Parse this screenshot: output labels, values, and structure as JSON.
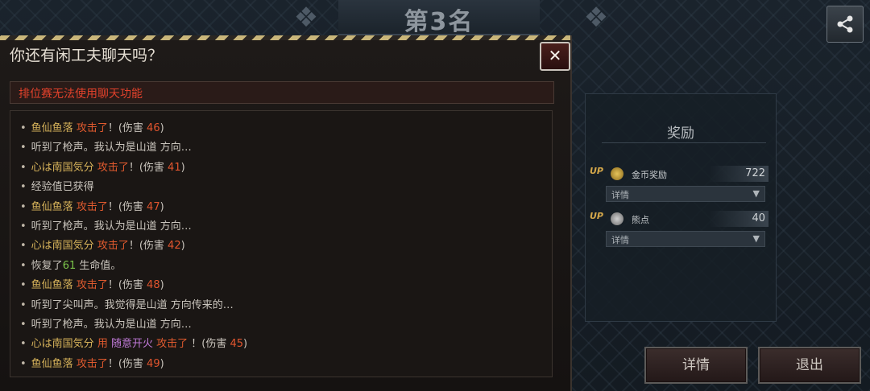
{
  "header": {
    "rank_title": "第3名"
  },
  "popup": {
    "title": "你还有闲工夫聊天吗？",
    "close_label": "✕",
    "notice": "排位赛无法使用聊天功能",
    "log": [
      {
        "parts": [
          {
            "t": "鱼仙鱼落",
            "c": "name"
          },
          {
            "t": "  攻击了",
            "c": "atk"
          },
          {
            "t": "！(伤害 ",
            "c": "plain"
          },
          {
            "t": "46",
            "c": "num"
          },
          {
            "t": ")",
            "c": "plain"
          }
        ]
      },
      {
        "parts": [
          {
            "t": "听到了枪声。我认为是山道 方向…",
            "c": "plain"
          }
        ]
      },
      {
        "parts": [
          {
            "t": "心は南国気分",
            "c": "name"
          },
          {
            "t": "  攻击了",
            "c": "atk"
          },
          {
            "t": "！(伤害 ",
            "c": "plain"
          },
          {
            "t": "41",
            "c": "num"
          },
          {
            "t": ")",
            "c": "plain"
          }
        ]
      },
      {
        "parts": [
          {
            "t": "经验值已获得",
            "c": "plain"
          }
        ]
      },
      {
        "parts": [
          {
            "t": "鱼仙鱼落",
            "c": "name"
          },
          {
            "t": "  攻击了",
            "c": "atk"
          },
          {
            "t": "！(伤害 ",
            "c": "plain"
          },
          {
            "t": "47",
            "c": "num"
          },
          {
            "t": ")",
            "c": "plain"
          }
        ]
      },
      {
        "parts": [
          {
            "t": "听到了枪声。我认为是山道 方向…",
            "c": "plain"
          }
        ]
      },
      {
        "parts": [
          {
            "t": "心は南国気分",
            "c": "name"
          },
          {
            "t": "  攻击了",
            "c": "atk"
          },
          {
            "t": "！(伤害 ",
            "c": "plain"
          },
          {
            "t": "42",
            "c": "num"
          },
          {
            "t": ")",
            "c": "plain"
          }
        ]
      },
      {
        "parts": [
          {
            "t": "恢复了",
            "c": "plain"
          },
          {
            "t": "61",
            "c": "heal"
          },
          {
            "t": " 生命值。",
            "c": "plain"
          }
        ]
      },
      {
        "parts": [
          {
            "t": "鱼仙鱼落",
            "c": "name"
          },
          {
            "t": "  攻击了",
            "c": "atk"
          },
          {
            "t": "！(伤害 ",
            "c": "plain"
          },
          {
            "t": "48",
            "c": "num"
          },
          {
            "t": ")",
            "c": "plain"
          }
        ]
      },
      {
        "parts": [
          {
            "t": "听到了尖叫声。我觉得是山道 方向传来的…",
            "c": "plain"
          }
        ]
      },
      {
        "parts": [
          {
            "t": "听到了枪声。我认为是山道 方向…",
            "c": "plain"
          }
        ]
      },
      {
        "parts": [
          {
            "t": "心は南国気分",
            "c": "name"
          },
          {
            "t": "  用 ",
            "c": "atk"
          },
          {
            "t": "随意开火",
            "c": "skill"
          },
          {
            "t": " 攻击了",
            "c": "atk"
          },
          {
            "t": " ！(伤害 ",
            "c": "plain"
          },
          {
            "t": "45",
            "c": "num"
          },
          {
            "t": ")",
            "c": "plain"
          }
        ]
      },
      {
        "parts": [
          {
            "t": "鱼仙鱼落",
            "c": "name"
          },
          {
            "t": "  攻击了",
            "c": "atk"
          },
          {
            "t": "！(伤害 ",
            "c": "plain"
          },
          {
            "t": "49",
            "c": "num"
          },
          {
            "t": ")",
            "c": "plain"
          }
        ]
      }
    ]
  },
  "rewards": {
    "title": "奖励",
    "items": [
      {
        "badge": "UP",
        "icon": "coin-icon",
        "label": "金币奖励",
        "value": "722",
        "detail": "详情"
      },
      {
        "badge": "UP",
        "icon": "bear-icon",
        "label": "熊点",
        "value": "40",
        "detail": "详情"
      }
    ],
    "dropdown_arrow": "▼"
  },
  "buttons": {
    "details": "详情",
    "exit": "退出"
  },
  "icons": {
    "share": "share-icon"
  },
  "colors": {
    "accent_red": "#e0412b",
    "name_gold": "#d6b25a",
    "heal_green": "#7bc44a",
    "skill_purple": "#c07ad8"
  }
}
